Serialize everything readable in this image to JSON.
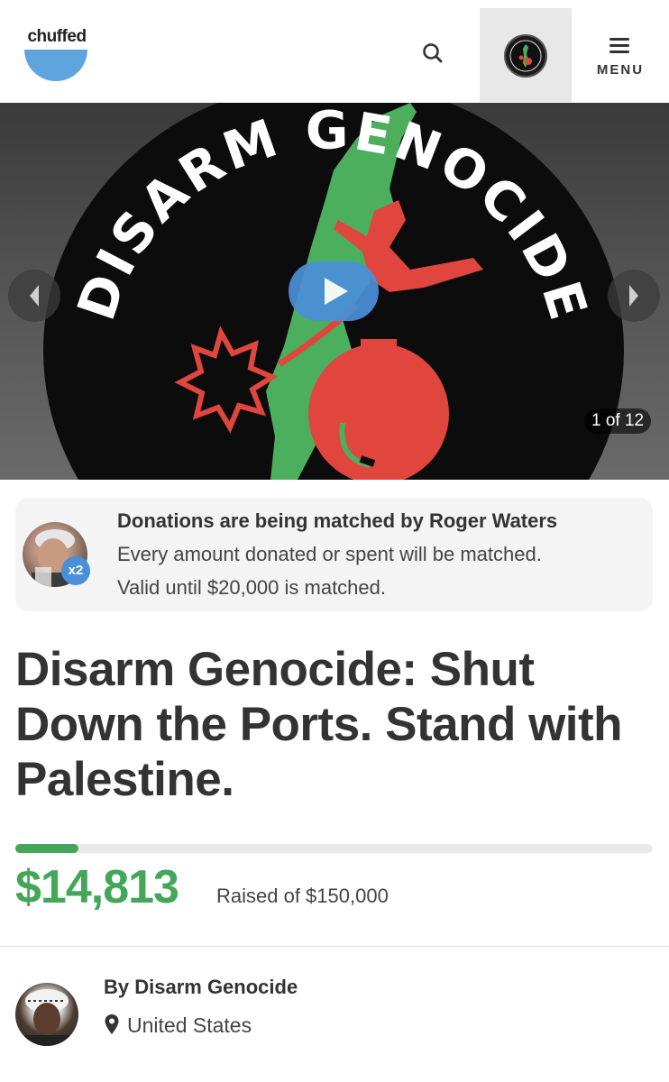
{
  "header": {
    "logo_text": "chuffed",
    "search_icon": "search-icon",
    "avatar_icon": "user-avatar",
    "menu_label": "MENU",
    "menu_icon": "hamburger-icon"
  },
  "hero": {
    "artwork_text": "DISARM GENOCIDE",
    "counter": "1 of 12",
    "prev_icon": "chevron-left-icon",
    "next_icon": "chevron-right-icon",
    "play_icon": "play-icon",
    "colors": {
      "green": "#4caf5e",
      "red": "#e0453e",
      "black": "#0c0c0c"
    }
  },
  "match": {
    "title": "Donations are being matched by Roger Waters",
    "line1": "Every amount donated or spent will be matched.",
    "line2": "Valid until $20,000 is matched.",
    "badge": "x2"
  },
  "campaign": {
    "title": "Disarm Genocide: Shut Down the Ports. Stand with Palestine.",
    "raised": "$14,813",
    "goal_text": "Raised of $150,000",
    "progress_fraction": 0.0988,
    "accent_color": "#43a659"
  },
  "organizer": {
    "by": "By Disarm Genocide",
    "location": "United States",
    "location_icon": "map-pin-icon"
  }
}
